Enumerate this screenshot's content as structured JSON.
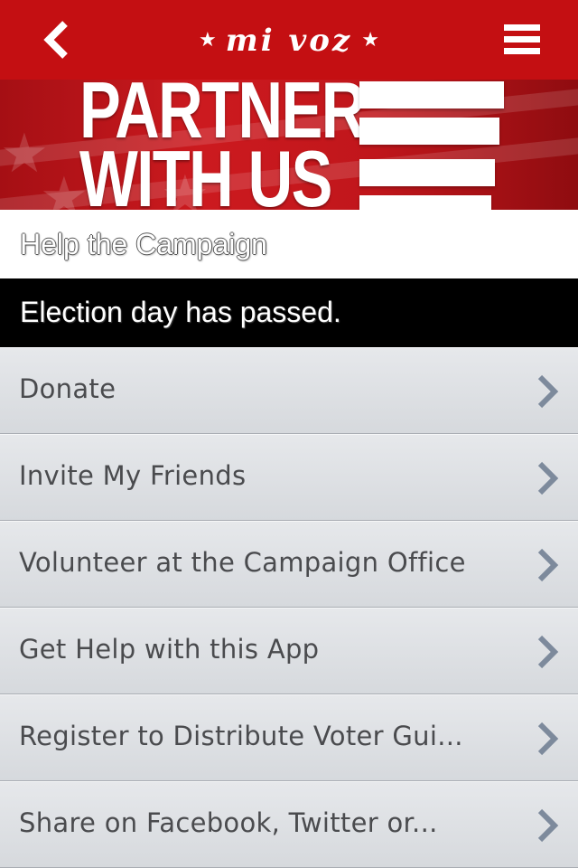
{
  "nav": {
    "logo_text": "mi voz",
    "logo_star_left": "★",
    "logo_star_right": "★",
    "back_icon": "chevron-left-icon",
    "menu_icon": "hamburger-menu-icon"
  },
  "banner": {
    "line1": "PARTNER",
    "line2": "WITH US"
  },
  "section": {
    "title": "Help the Campaign"
  },
  "notice": {
    "text": "Election day has passed."
  },
  "list": {
    "items": [
      {
        "label": "Donate"
      },
      {
        "label": "Invite My Friends"
      },
      {
        "label": "Volunteer at the Campaign Office"
      },
      {
        "label": "Get Help with this App"
      },
      {
        "label": "Register to Distribute Voter Gui..."
      },
      {
        "label": "Share on Facebook, Twitter or..."
      }
    ]
  },
  "colors": {
    "nav_red": "#c40f12",
    "list_text": "#4a4b4e",
    "chevron": "#7d8a9c"
  }
}
